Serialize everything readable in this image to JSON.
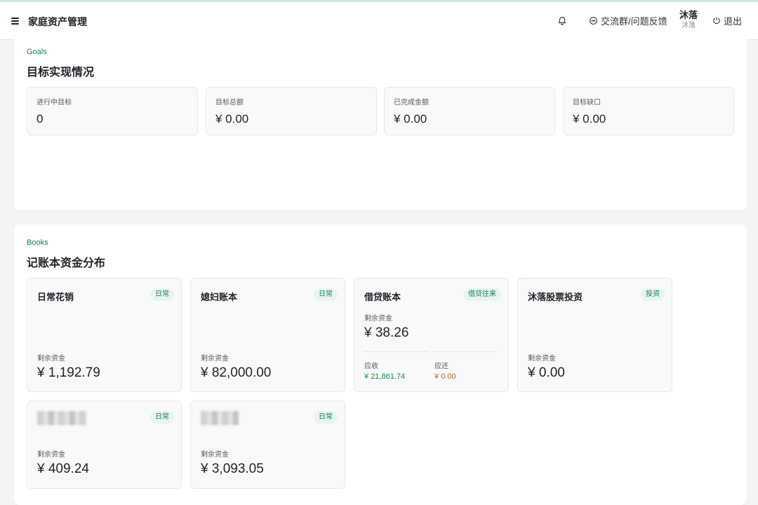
{
  "header": {
    "title": "家庭资产管理",
    "feedback_label": "交流群/问题反馈",
    "user_name": "沐落",
    "user_sub": "沐落",
    "logout_label": "退出"
  },
  "goals": {
    "section_en": "Goals",
    "section_title": "目标实现情况",
    "stats": [
      {
        "label": "进行中目标",
        "value": "0"
      },
      {
        "label": "目标总额",
        "value": "¥ 0.00"
      },
      {
        "label": "已完成金额",
        "value": "¥ 0.00"
      },
      {
        "label": "目标缺口",
        "value": "¥ 0.00"
      }
    ]
  },
  "books": {
    "section_en": "Books",
    "section_title": "记账本资金分布",
    "items": [
      {
        "name": "日常花销",
        "tag": "日常",
        "remain_label": "剩余资金",
        "remain_value": "¥ 1,192.79"
      },
      {
        "name": "媳妇账本",
        "tag": "日常",
        "remain_label": "剩余资金",
        "remain_value": "¥ 82,000.00"
      },
      {
        "name": "借贷账本",
        "tag": "借贷往来",
        "remain_label": "剩余资金",
        "remain_value": "¥ 38.26",
        "receivable_label": "应收",
        "receivable_value": "¥ 21,861.74",
        "payable_label": "应还",
        "payable_value": "¥ 0.00"
      },
      {
        "name": "沐落股票投资",
        "tag": "投资",
        "remain_label": "剩余资金",
        "remain_value": "¥ 0.00"
      },
      {
        "name": "",
        "tag": "日常",
        "remain_label": "剩余资金",
        "remain_value": "¥ 409.24"
      },
      {
        "name": "",
        "tag": "日常",
        "remain_label": "剩余资金",
        "remain_value": "¥ 3,093.05"
      }
    ]
  },
  "colors": {
    "accent": "#12805c",
    "receivable": "#1f8a4c",
    "payable": "#d0611e"
  }
}
